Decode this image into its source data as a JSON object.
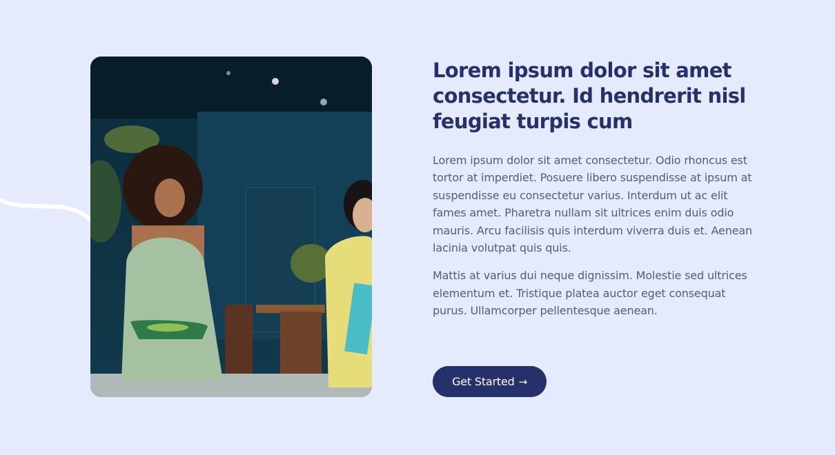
{
  "hero": {
    "title": "Lorem ipsum dolor sit amet consectetur. Id hendrerit nisl feugiat turpis cum",
    "paragraph_1": "Lorem ipsum dolor sit amet consectetur. Odio rhoncus est tortor at imperdiet. Posuere libero suspendisse at ipsum at suspendisse eu consectetur varius. Interdum ut ac elit fames amet. Pharetra nullam sit ultrices enim duis odio mauris. Arcu facilisis quis interdum viverra duis et. Aenean lacinia volutpat quis quis.",
    "paragraph_2": "Mattis at varius dui neque dignissim. Molestie sed ultrices elementum et. Tristique platea auctor eget consequat purus. Ullamcorper pellentesque aenean.",
    "cta_label": "Get Started",
    "cta_icon": "arrow-right-icon"
  },
  "colors": {
    "background": "#e5eafc",
    "title": "#26306b",
    "body_text": "#565d70",
    "button": "#26306b"
  }
}
